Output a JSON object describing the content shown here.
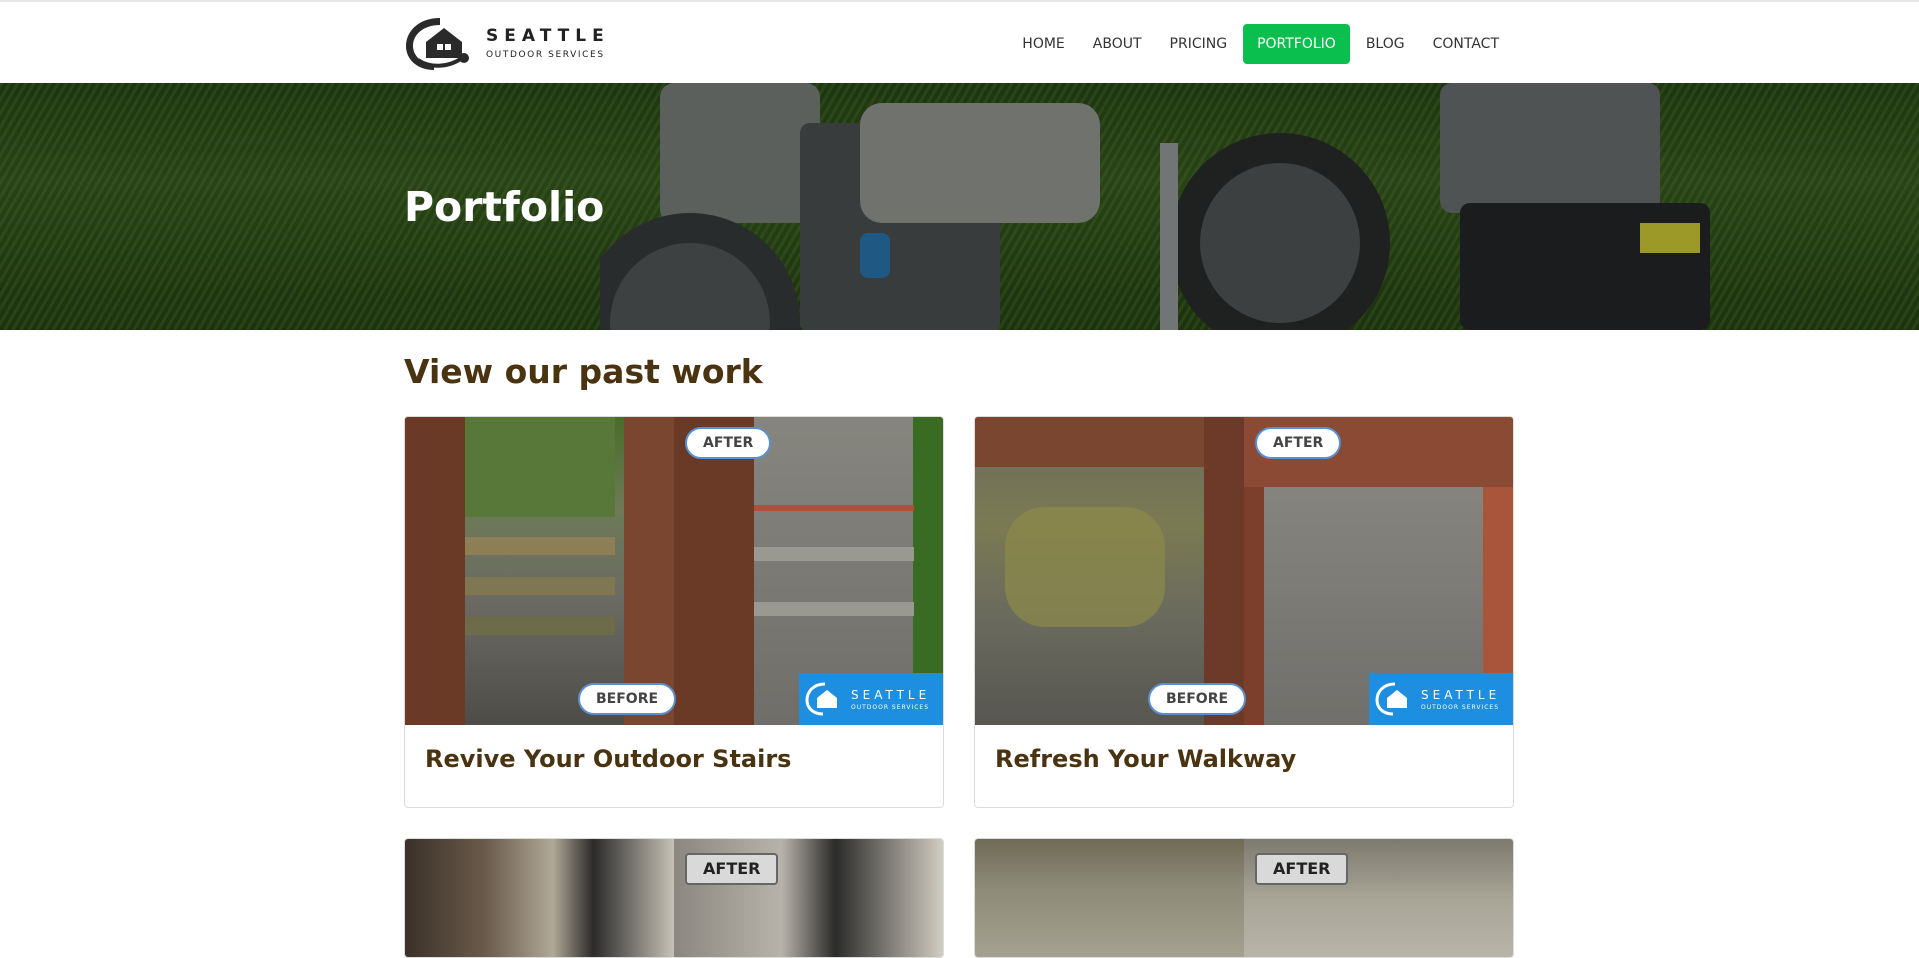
{
  "brand": {
    "name": "SEATTLE",
    "tagline": "OUTDOOR SERVICES"
  },
  "nav": {
    "home": "HOME",
    "about": "ABOUT",
    "pricing": "PRICING",
    "portfolio": "PORTFOLIO",
    "blog": "BLOG",
    "contact": "CONTACT",
    "active": "PORTFOLIO",
    "active_color": "#0bbf4f"
  },
  "hero": {
    "title": "Portfolio"
  },
  "section": {
    "title": "View our past work"
  },
  "cards": [
    {
      "title": "Revive Your Outdoor Stairs",
      "before_label": "BEFORE",
      "after_label": "AFTER"
    },
    {
      "title": "Refresh Your Walkway",
      "before_label": "BEFORE",
      "after_label": "AFTER"
    },
    {
      "after_label": "AFTER"
    },
    {
      "after_label": "AFTER"
    }
  ],
  "colors": {
    "heading": "#4a3310",
    "brand_blue": "#1e8fe0"
  }
}
